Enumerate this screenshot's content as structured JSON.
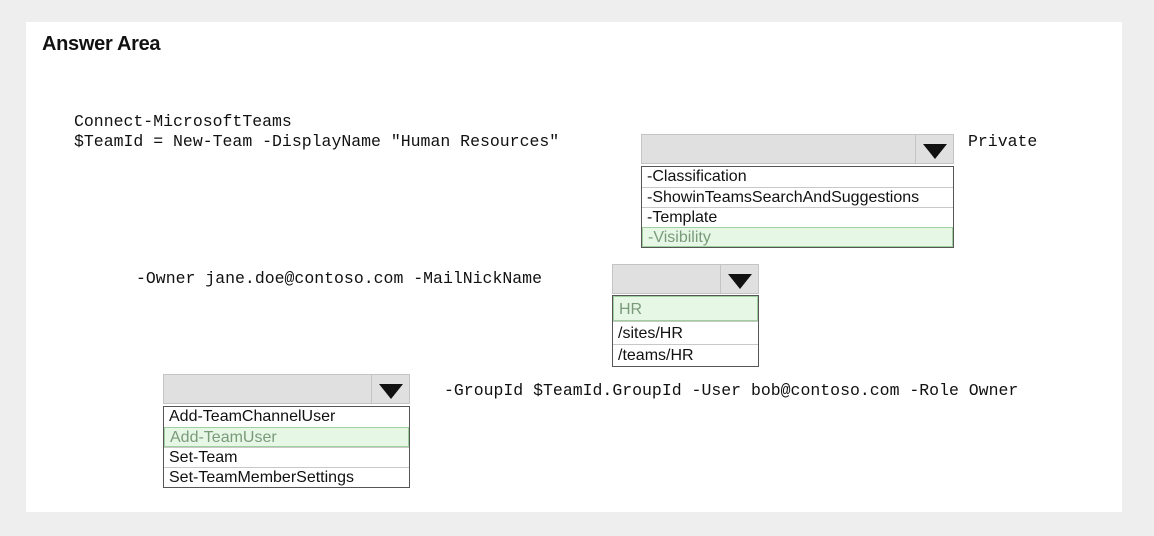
{
  "title": "Answer Area",
  "code": {
    "line1": "Connect-MicrosoftTeams",
    "line2": "$TeamId = New-Team -DisplayName \"Human Resources\"",
    "line2_suffix": "Private",
    "line3": "-Owner jane.doe@contoso.com -MailNickName",
    "line4_suffix": "-GroupId $TeamId.GroupId -User bob@contoso.com -Role Owner"
  },
  "dropdowns": [
    {
      "options": [
        "-Classification",
        "-ShowinTeamsSearchAndSuggestions",
        "-Template",
        "-Visibility"
      ],
      "selected": "-Visibility"
    },
    {
      "options": [
        "HR",
        "/sites/HR",
        "/teams/HR"
      ],
      "selected": "HR"
    },
    {
      "options": [
        "Add-TeamChannelUser",
        "Add-TeamUser",
        "Set-Team",
        "Set-TeamMemberSettings"
      ],
      "selected": "Add-TeamUser"
    }
  ],
  "colors": {
    "selected_bg": "#e6f7e6",
    "selected_text": "#7a9a7a",
    "dropdown_head": "#e0e0e0"
  }
}
